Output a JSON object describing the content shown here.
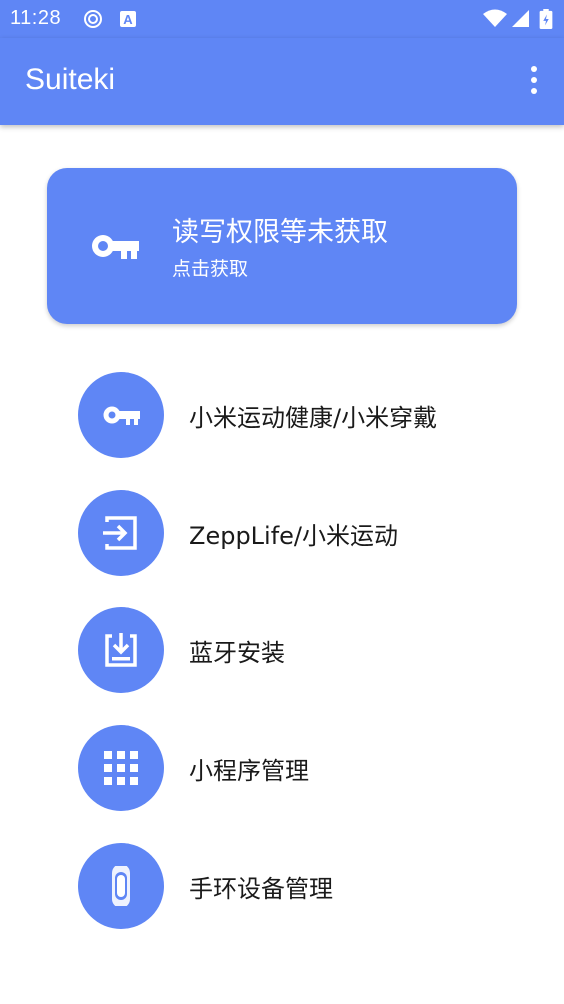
{
  "status_bar": {
    "time": "11:28",
    "icons": [
      "sync-icon",
      "font-a-icon",
      "wifi-icon",
      "signal-icon",
      "battery-icon"
    ]
  },
  "app_bar": {
    "title": "Suiteki",
    "menu_icon": "more-vert-icon"
  },
  "permission_card": {
    "title": "读写权限等未获取",
    "subtitle": "点击获取",
    "icon": "key-icon"
  },
  "menu": [
    {
      "label": "小米运动健康/小米穿戴",
      "icon": "key-icon"
    },
    {
      "label": "ZeppLife/小米运动",
      "icon": "login-icon"
    },
    {
      "label": "蓝牙安装",
      "icon": "install-icon"
    },
    {
      "label": "小程序管理",
      "icon": "apps-grid-icon"
    },
    {
      "label": "手环设备管理",
      "icon": "band-icon"
    }
  ],
  "colors": {
    "accent": "#5f86f5",
    "text": "#1a1a1a",
    "background": "#ffffff"
  }
}
